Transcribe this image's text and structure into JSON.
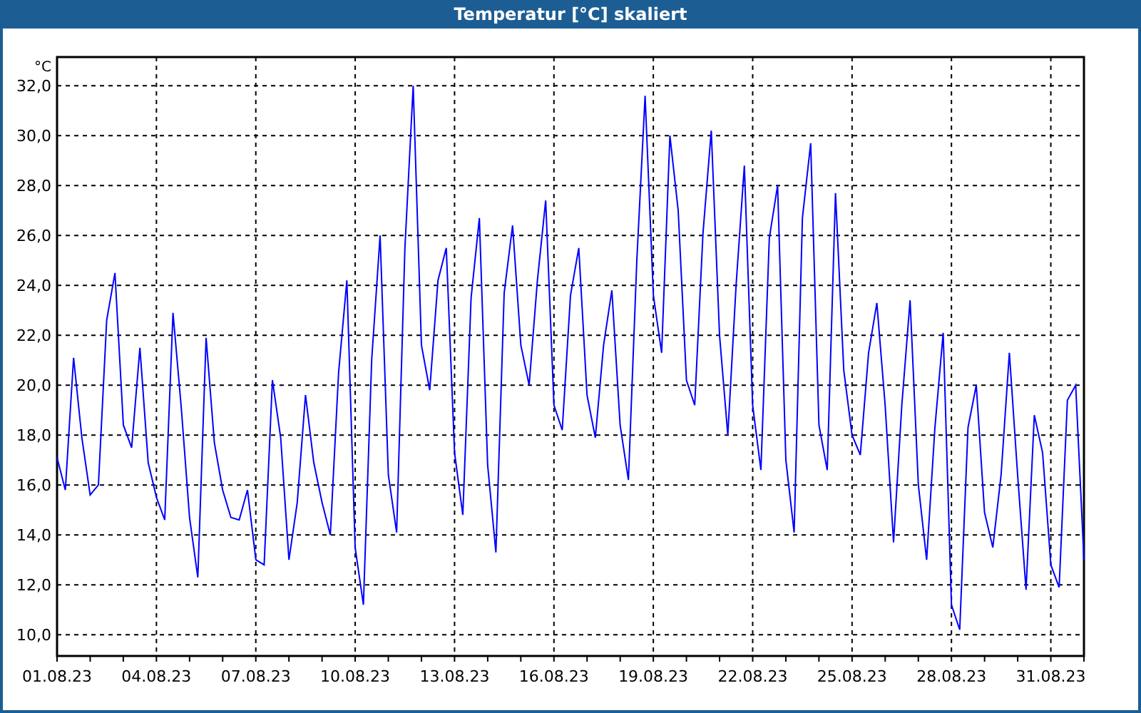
{
  "window": {
    "title": "Temperatur [°C] skaliert"
  },
  "chart": {
    "chart_data": {
      "type": "line",
      "ylabel": "°C",
      "categories": [
        "01.08.23",
        null,
        null,
        null,
        null,
        null,
        null,
        null,
        null,
        null,
        null,
        null,
        "04.08.23",
        null,
        null,
        null,
        null,
        null,
        null,
        null,
        null,
        null,
        null,
        null,
        "07.08.23",
        null,
        null,
        null,
        null,
        null,
        null,
        null,
        null,
        null,
        null,
        null,
        "10.08.23",
        null,
        null,
        null,
        null,
        null,
        null,
        null,
        null,
        null,
        null,
        null,
        "13.08.23",
        null,
        null,
        null,
        null,
        null,
        null,
        null,
        null,
        null,
        null,
        null,
        "16.08.23",
        null,
        null,
        null,
        null,
        null,
        null,
        null,
        null,
        null,
        null,
        null,
        "19.08.23",
        null,
        null,
        null,
        null,
        null,
        null,
        null,
        null,
        null,
        null,
        null,
        "22.08.23",
        null,
        null,
        null,
        null,
        null,
        null,
        null,
        null,
        null,
        null,
        null,
        "25.08.23",
        null,
        null,
        null,
        null,
        null,
        null,
        null,
        null,
        null,
        null,
        null,
        "28.08.23",
        null,
        null,
        null,
        null,
        null,
        null,
        null,
        null,
        null,
        null,
        null,
        "31.08.23",
        null,
        null,
        null,
        null
      ],
      "series": [
        {
          "color": "#0000ff",
          "values": [
            17.1,
            15.8,
            21.1,
            17.9,
            15.6,
            16.0,
            22.6,
            24.5,
            18.4,
            17.5,
            21.5,
            16.9,
            15.5,
            14.6,
            22.9,
            19.1,
            14.7,
            12.3,
            21.9,
            17.7,
            15.8,
            14.7,
            14.6,
            15.8,
            13.0,
            12.8,
            20.2,
            17.9,
            13.0,
            15.3,
            19.6,
            16.9,
            15.3,
            14.0,
            20.5,
            24.2,
            13.5,
            11.2,
            21.0,
            26.0,
            16.4,
            14.1,
            25.5,
            32.0,
            21.6,
            19.8,
            24.2,
            25.5,
            17.3,
            14.8,
            23.5,
            26.7,
            16.8,
            13.3,
            23.7,
            26.4,
            21.6,
            20.0,
            24.2,
            27.4,
            19.2,
            18.2,
            23.6,
            25.5,
            19.6,
            17.9,
            21.6,
            23.8,
            18.4,
            16.2,
            25.0,
            31.6,
            23.6,
            21.3,
            30.0,
            27.0,
            20.2,
            19.2,
            26.1,
            30.2,
            22.0,
            18.0,
            24.0,
            28.8,
            19.2,
            16.6,
            25.9,
            28.0,
            17.0,
            14.1,
            26.7,
            29.7,
            18.4,
            16.6,
            27.7,
            20.6,
            18.0,
            17.2,
            21.3,
            23.3,
            19.2,
            13.7,
            19.2,
            23.4,
            16.0,
            13.0,
            18.3,
            22.1,
            11.2,
            10.2,
            18.3,
            20.0,
            14.9,
            13.5,
            16.4,
            21.3,
            16.4,
            11.8,
            18.8,
            17.3,
            12.8,
            11.9,
            19.4,
            20.0,
            13.0
          ]
        }
      ],
      "grid": true,
      "ylim": [
        9.15,
        33.15
      ],
      "yticks": [
        {
          "value": 10,
          "label": "10,0"
        },
        {
          "value": 12,
          "label": "12,0"
        },
        {
          "value": 14,
          "label": "14,0"
        },
        {
          "value": 16,
          "label": "16,0"
        },
        {
          "value": 18,
          "label": "18,0"
        },
        {
          "value": 20,
          "label": "20,0"
        },
        {
          "value": 22,
          "label": "22,0"
        },
        {
          "value": 24,
          "label": "24,0"
        },
        {
          "value": 26,
          "label": "26,0"
        },
        {
          "value": 28,
          "label": "28,0"
        },
        {
          "value": 30,
          "label": "30,0"
        },
        {
          "value": 32,
          "label": "32,0"
        }
      ]
    }
  }
}
